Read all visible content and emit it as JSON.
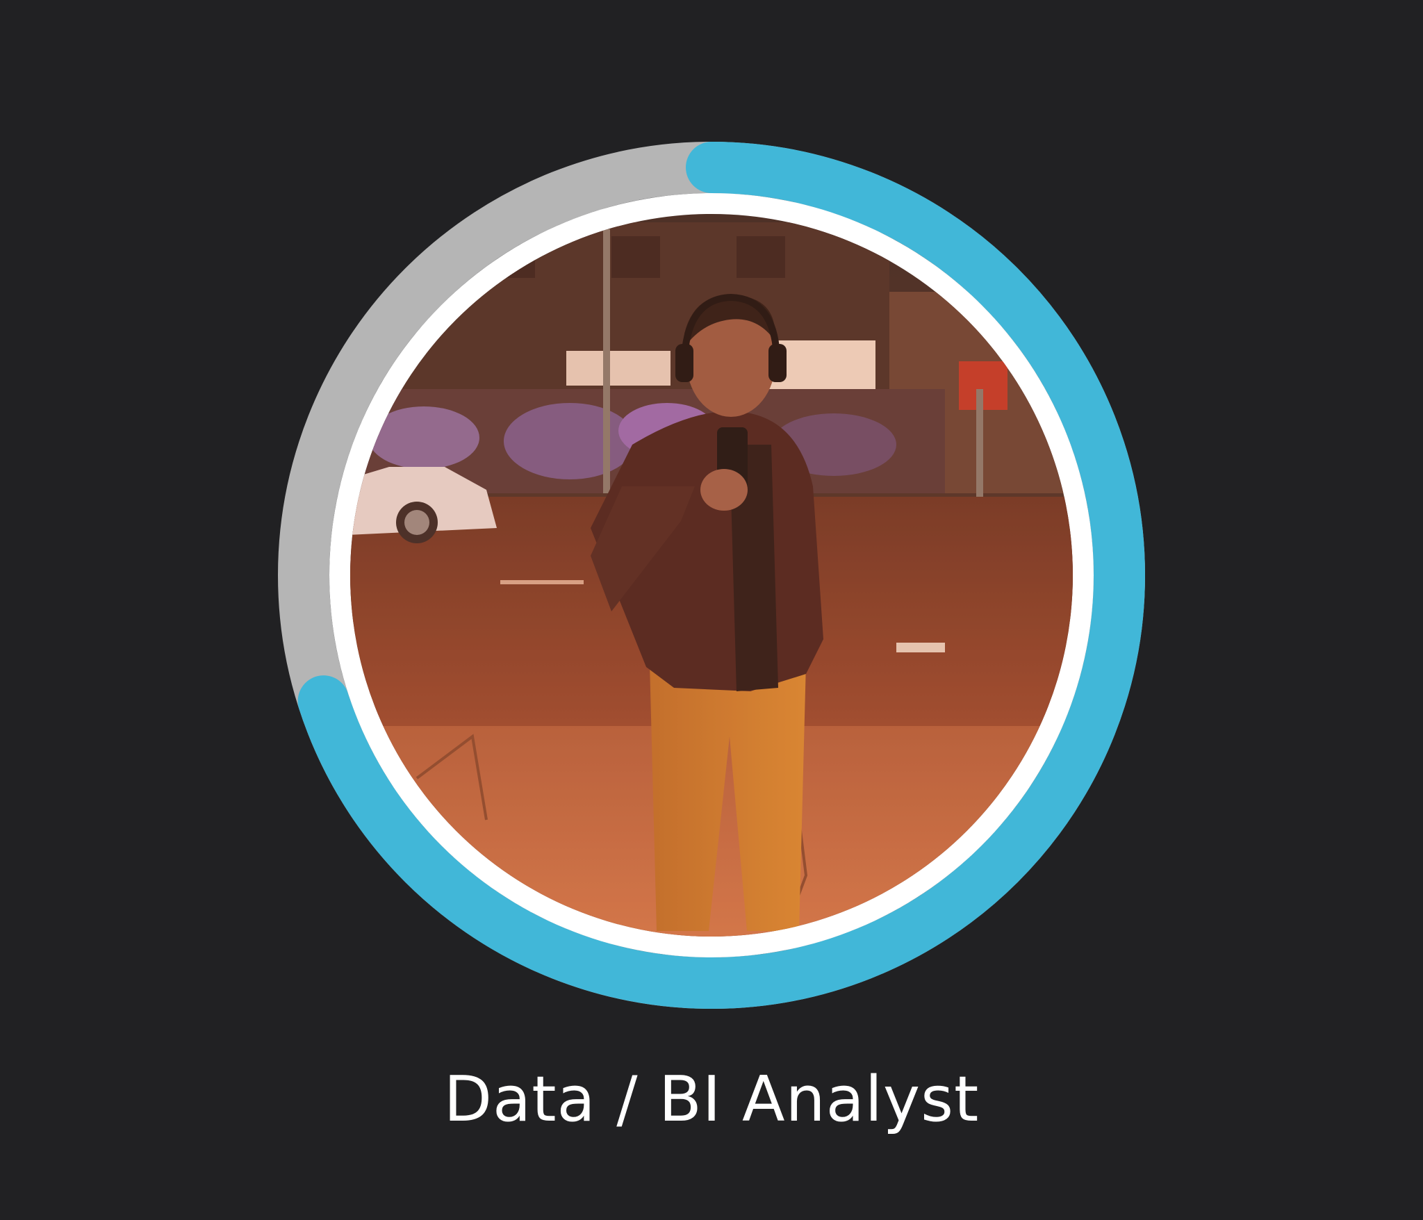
{
  "profile": {
    "role_title": "Data / BI Analyst",
    "photo_alt": "profile photo: person with headphones taking a mirror selfie on a city street at night",
    "progress": {
      "value_fraction": 0.7,
      "track_color": "#b5b5b5",
      "fill_color": "#41b7d8"
    },
    "inner_border_color": "#ffffff",
    "background_color": "#212123"
  }
}
